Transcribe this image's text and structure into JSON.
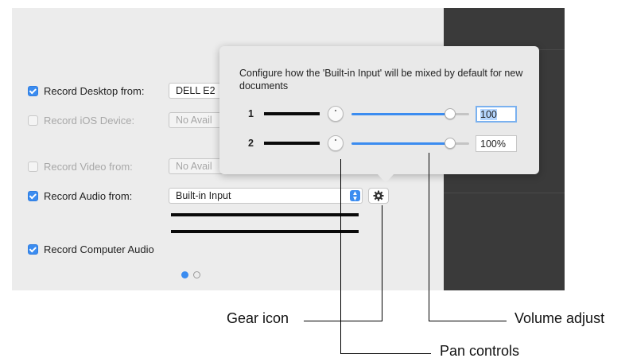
{
  "settings": {
    "record_desktop": {
      "label": "Record Desktop from:",
      "checked": true,
      "value": "DELL E2"
    },
    "record_ios": {
      "label": "Record iOS Device:",
      "checked": false,
      "value": "No Avail"
    },
    "record_video": {
      "label": "Record Video from:",
      "checked": false,
      "value": "No Avail"
    },
    "record_audio": {
      "label": "Record Audio from:",
      "checked": true,
      "value": "Built-in Input"
    },
    "record_computer_audio": {
      "label": "Record Computer Audio",
      "checked": true
    }
  },
  "pagination": {
    "pages": 2,
    "current": 1
  },
  "popover": {
    "description": "Configure how the 'Built-in Input' will be mixed by default for new documents",
    "channels": [
      {
        "number": "1",
        "volume_fraction": 0.85,
        "volume_text": "100",
        "focused": true
      },
      {
        "number": "2",
        "volume_fraction": 0.85,
        "volume_text": "100%",
        "focused": false
      }
    ]
  },
  "callouts": {
    "gear": "Gear icon",
    "volume": "Volume adjust",
    "pan": "Pan controls"
  },
  "colors": {
    "accent": "#3b8cf0",
    "window_bg": "#ececec",
    "dark_panel": "#3a3a3a",
    "popover_bg": "#e9e9e9"
  },
  "icons": {
    "gear": "gear-icon",
    "select_arrows": "updown-chevron-icon"
  }
}
